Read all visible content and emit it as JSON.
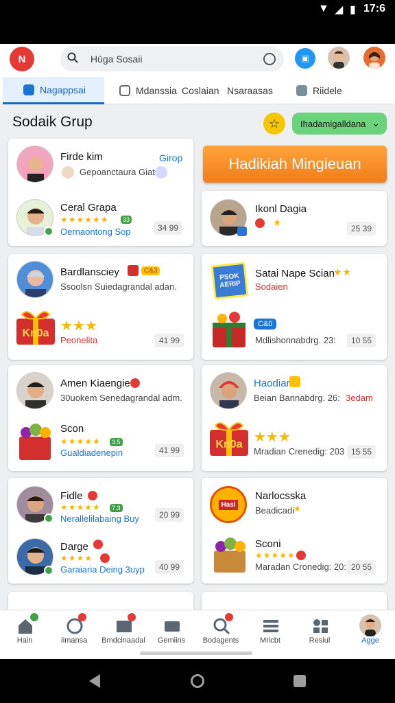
{
  "status_bar": {
    "time": "17:6"
  },
  "header": {
    "logo_text": "N",
    "search_placeholder": "Hūga Sosaii",
    "icons": {
      "search": "search-icon",
      "mic": "mic-icon",
      "chat": "chat-icon"
    }
  },
  "tabs": [
    {
      "label": "Nagappsai",
      "active": true
    },
    {
      "label": "Mdanssia",
      "active": false
    },
    {
      "label": "Coslaian",
      "active": false
    },
    {
      "label": "Nsaraasas",
      "active": false
    },
    {
      "label": "Riidele",
      "active": false
    }
  ],
  "section": {
    "title": "Sodaik Grup",
    "dropdown_label": "Ihadamigalldana",
    "promo_button": "Hadikiah Mingieuan"
  },
  "cards": {
    "c1": {
      "r1": {
        "name": "Firde kim",
        "sub": "Gepoanctaura Giat",
        "tag": "Girop"
      },
      "r2": {
        "name": "Ceral Grapa",
        "badge": "33",
        "sub": "Oernaontong Sop",
        "price": "34 99"
      }
    },
    "c2": {
      "name": "Ikonl Dagia",
      "price": "25 39"
    },
    "c3": {
      "name": "Bardlansciey",
      "badge": "C&3",
      "sub": "Ssoolsn Suiedagrandal adan.",
      "gift_text": "Kn0a",
      "footer": "Peonelita",
      "price": "41 99"
    },
    "c4": {
      "name": "Satai Nape Scian",
      "sub": "Sodaien",
      "book_text": "PSOK AERIP",
      "blue_tag": "C&0",
      "footer": "Mdlishonnabdrg. 23:",
      "price": "10 55"
    },
    "c5": {
      "name": "Amen Kiaengie",
      "sub": "30uokem Senedagrandal adm.",
      "r2_name": "Scon",
      "badge": "3.5",
      "r2_sub": "Gualdiadenepin",
      "price": "41 99"
    },
    "c6": {
      "name": "Haodiar",
      "sub": "Beian Bannabdrg. 26:",
      "red_label": "3edam",
      "gift_text": "Kn0a",
      "footer": "Mradian Crenedig: 203",
      "price": "15 55"
    },
    "c7": {
      "r1": {
        "name": "Fidle",
        "badge": "7.3",
        "sub": "Nerallelilabaing Buy",
        "price": "20 99"
      },
      "r2": {
        "name": "Darge",
        "sub": "Garaiaria Deing 3uyp",
        "price": "40 99"
      }
    },
    "c8": {
      "r1": {
        "name": "Narlocsska",
        "sub": "Beadicadi",
        "label_text": "Hasi"
      },
      "r2": {
        "name": "Sconi",
        "sub": "Maradan Cronedig: 20:",
        "price": "20 55"
      }
    }
  },
  "bottom_nav": [
    {
      "label": "Hain",
      "icon": "home-icon"
    },
    {
      "label": "Iimansa",
      "icon": "message-icon"
    },
    {
      "label": "Bmdcinaadal",
      "icon": "gallery-icon"
    },
    {
      "label": "Gemiins",
      "icon": "games-icon"
    },
    {
      "label": "Bodagents",
      "icon": "search-icon"
    },
    {
      "label": "Mricbt",
      "icon": "list-icon"
    },
    {
      "label": "Resiul",
      "icon": "stats-icon"
    },
    {
      "label": "Agge",
      "icon": "profile-icon"
    }
  ],
  "colors": {
    "accent": "#1565c0",
    "promo": "#f28c28",
    "pill": "#6cd37d"
  }
}
